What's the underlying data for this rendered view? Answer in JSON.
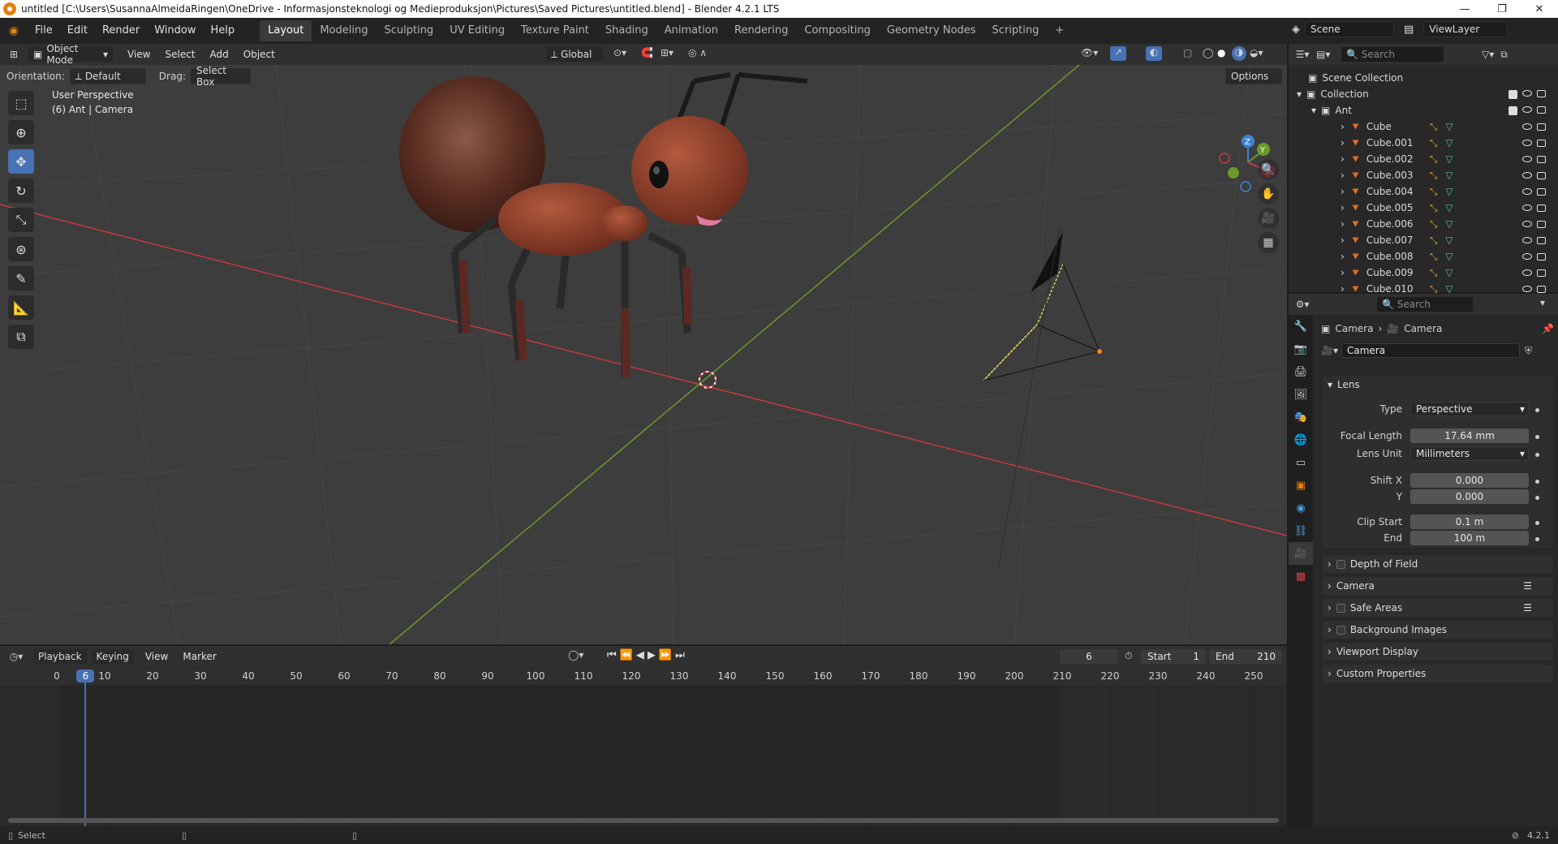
{
  "window": {
    "title": "untitled [C:\\Users\\SusannaAlmeidaRingen\\OneDrive - Informasjonsteknologi og Medieproduksjon\\Pictures\\Saved Pictures\\untitled.blend] - Blender 4.2.1 LTS"
  },
  "menu": [
    "File",
    "Edit",
    "Render",
    "Window",
    "Help"
  ],
  "workspaces": [
    "Layout",
    "Modeling",
    "Sculpting",
    "UV Editing",
    "Texture Paint",
    "Shading",
    "Animation",
    "Rendering",
    "Compositing",
    "Geometry Nodes",
    "Scripting"
  ],
  "active_workspace": "Layout",
  "scene": {
    "label": "Scene",
    "view_layer": "ViewLayer"
  },
  "viewport_header": {
    "mode": "Object Mode",
    "menus": [
      "View",
      "Select",
      "Add",
      "Object"
    ],
    "transform": "Global",
    "options": "Options"
  },
  "tool_settings": {
    "orientation_label": "Orientation:",
    "orientation_value": "Default",
    "drag_label": "Drag:",
    "drag_value": "Select Box"
  },
  "viewport": {
    "view_name": "User Perspective",
    "context": "(6) Ant | Camera",
    "gizmo_axes": [
      "Z",
      "Y",
      "X"
    ]
  },
  "timeline": {
    "menus": [
      "Playback",
      "Keying",
      "View",
      "Marker"
    ],
    "current_frame": "6",
    "start_label": "Start",
    "start_value": "1",
    "end_label": "End",
    "end_value": "210",
    "ticks": [
      "0",
      "10",
      "20",
      "30",
      "40",
      "50",
      "60",
      "70",
      "80",
      "90",
      "100",
      "110",
      "120",
      "130",
      "140",
      "150",
      "160",
      "170",
      "180",
      "190",
      "200",
      "210",
      "220",
      "230",
      "240",
      "250"
    ]
  },
  "outliner": {
    "search_placeholder": "Search",
    "scene_collection": "Scene Collection",
    "collection": "Collection",
    "group": "Ant",
    "items": [
      "Cube",
      "Cube.001",
      "Cube.002",
      "Cube.003",
      "Cube.004",
      "Cube.005",
      "Cube.006",
      "Cube.007",
      "Cube.008",
      "Cube.009",
      "Cube.010"
    ]
  },
  "properties": {
    "search_placeholder": "Search",
    "breadcrumb": [
      "Camera",
      "Camera"
    ],
    "datablock": "Camera",
    "lens_panel": "Lens",
    "type_label": "Type",
    "type_value": "Perspective",
    "focal_label": "Focal Length",
    "focal_value": "17.64 mm",
    "lens_unit_label": "Lens Unit",
    "lens_unit_value": "Millimeters",
    "shift_x_label": "Shift X",
    "shift_x_value": "0.000",
    "shift_y_label": "Y",
    "shift_y_value": "0.000",
    "clip_start_label": "Clip Start",
    "clip_start_value": "0.1 m",
    "clip_end_label": "End",
    "clip_end_value": "100 m",
    "panels": [
      "Depth of Field",
      "Camera",
      "Safe Areas",
      "Background Images",
      "Viewport Display",
      "Custom Properties"
    ]
  },
  "status": {
    "left": "Select",
    "version": "4.2.1"
  },
  "colors": {
    "accent": "#4772b3",
    "x_axis": "#c8383e",
    "y_axis": "#6a9a2a",
    "z_axis": "#3d82d6",
    "ant_body": "#7a3624"
  }
}
